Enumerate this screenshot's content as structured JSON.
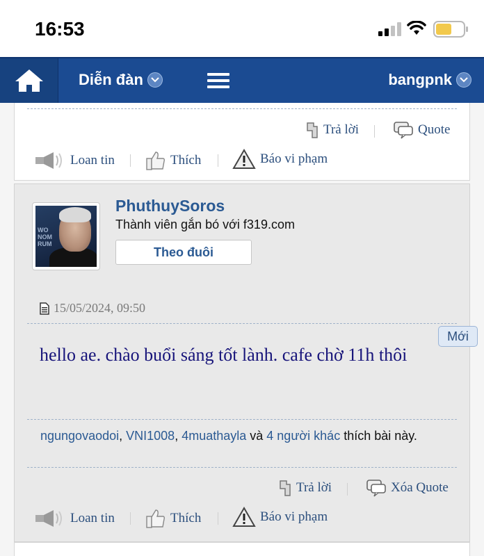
{
  "status_bar": {
    "time": "16:53"
  },
  "nav": {
    "forum_label": "Diễn đàn",
    "username": "bangpnk"
  },
  "prev_post_actions": {
    "reply": "Trả lời",
    "quote": "Quote",
    "share": "Loan tin",
    "like": "Thích",
    "report": "Báo vi phạm"
  },
  "post": {
    "author": "PhuthuySoros",
    "rank": "Thành viên gắn bó với f319.com",
    "follow_label": "Theo đuôi",
    "date": "15/05/2024, 09:50",
    "new_badge": "Mới",
    "message": "hello ae. chào buổi sáng tốt lành. cafe chờ 11h thôi",
    "likers": [
      "ngungovaodoi",
      "VNI1008",
      "4muathayla"
    ],
    "likers_sep": ", ",
    "likes_and": " và ",
    "likes_others": "4 người khác",
    "likes_suffix": " thích bài này.",
    "actions": {
      "reply": "Trả lời",
      "quote": "Xóa Quote",
      "share": "Loan tin",
      "like": "Thích",
      "report": "Báo vi phạm"
    }
  },
  "colors": {
    "nav_bg": "#1b4b92",
    "link": "#2b5a93",
    "message_text": "#17147a"
  }
}
